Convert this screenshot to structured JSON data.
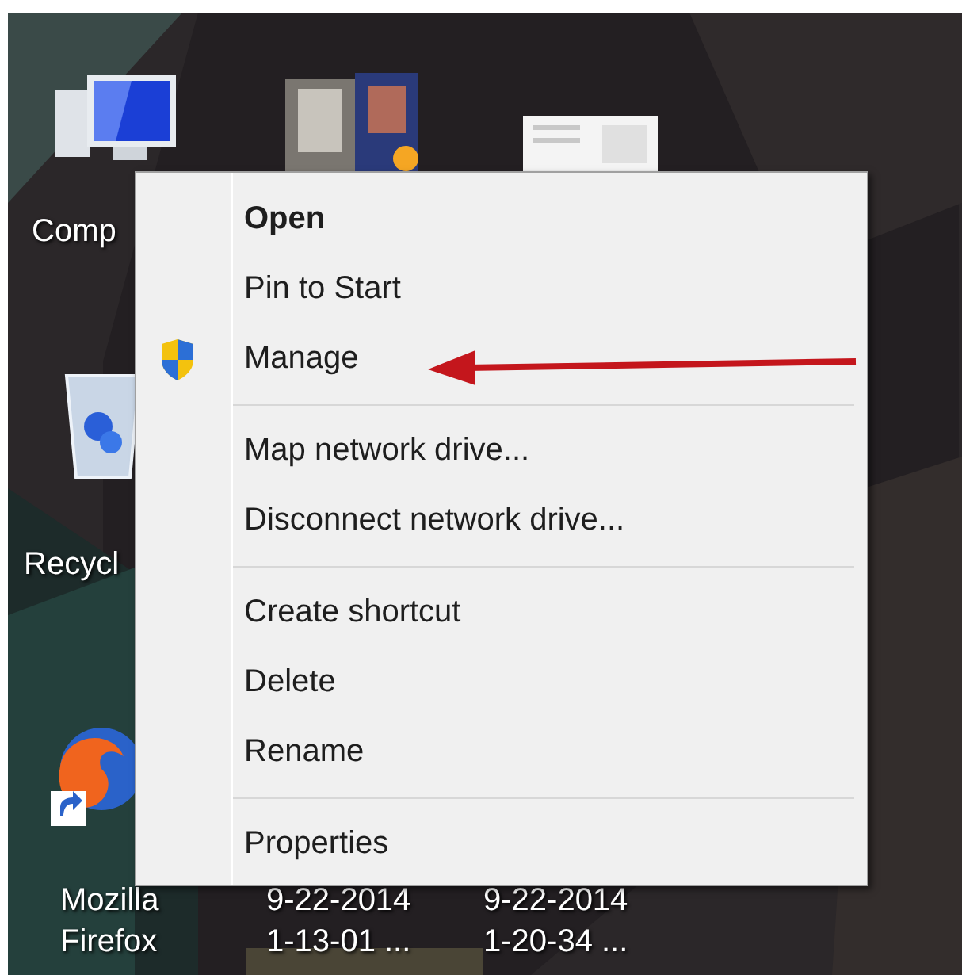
{
  "desktop_icons": [
    {
      "kind": "computer",
      "label": "Comp"
    },
    {
      "kind": "photos"
    },
    {
      "kind": "document"
    },
    {
      "kind": "recycle-bin",
      "label": "Recycl"
    },
    {
      "kind": "firefox",
      "label": "Mozilla\nFirefox"
    },
    {
      "kind": "file",
      "label": "9-22-2014\n1-13-01 ..."
    },
    {
      "kind": "file",
      "label": "9-22-2014\n1-20-34 ..."
    }
  ],
  "context_menu": [
    {
      "kind": "item",
      "label": "Open",
      "default": true
    },
    {
      "kind": "item",
      "label": "Pin to Start",
      "default": false
    },
    {
      "kind": "shield-item",
      "label": "Manage",
      "default": false
    },
    {
      "kind": "separator"
    },
    {
      "kind": "item",
      "label": "Map network drive...",
      "default": false
    },
    {
      "kind": "item",
      "label": "Disconnect network drive...",
      "default": false
    },
    {
      "kind": "separator"
    },
    {
      "kind": "item",
      "label": "Create shortcut",
      "default": false
    },
    {
      "kind": "item",
      "label": "Delete",
      "default": false
    },
    {
      "kind": "item",
      "label": "Rename",
      "default": false
    },
    {
      "kind": "separator"
    },
    {
      "kind": "item",
      "label": "Properties",
      "default": false
    }
  ]
}
